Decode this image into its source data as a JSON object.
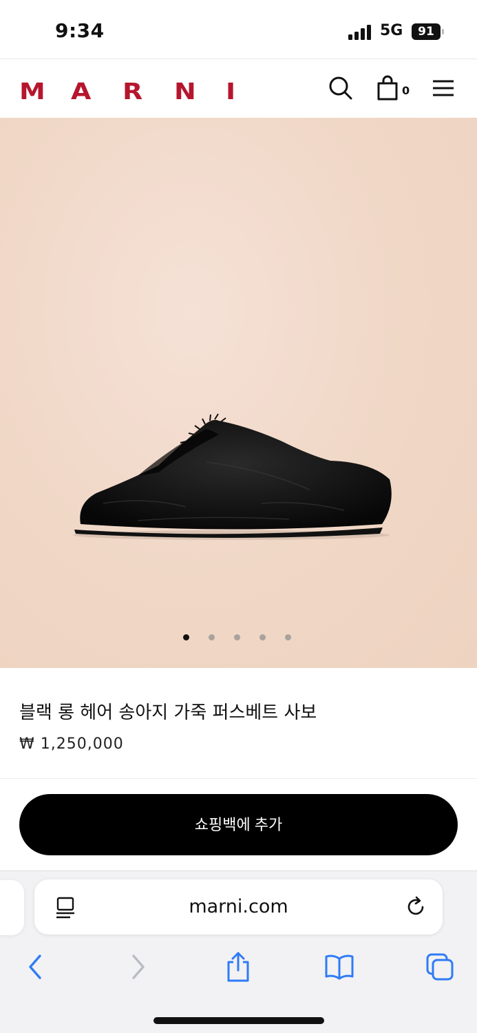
{
  "status_bar": {
    "time": "9:34",
    "network": "5G",
    "battery": "91"
  },
  "header": {
    "logo_letters": [
      "M",
      "A",
      "R",
      "N",
      "I"
    ],
    "bag_count": "0",
    "icons": [
      "search-icon",
      "shopping-bag-icon",
      "hamburger-menu-icon"
    ],
    "brand_color": "#b5162e"
  },
  "gallery": {
    "image_subject": "black long hair calfskin fussbett sabot",
    "background_color": "#f2dccc",
    "slide_count": 5,
    "active_slide": 1
  },
  "product": {
    "name": "블랙 롱 헤어 송아지 가죽 퍼스베트 사보",
    "price": "₩ 1,250,000"
  },
  "cta": {
    "add_to_bag_label": "쇼핑백에 추가"
  },
  "browser": {
    "url": "marni.com",
    "toolbar_icons": [
      "back-icon",
      "forward-icon",
      "share-icon",
      "bookmarks-icon",
      "tabs-icon"
    ]
  }
}
